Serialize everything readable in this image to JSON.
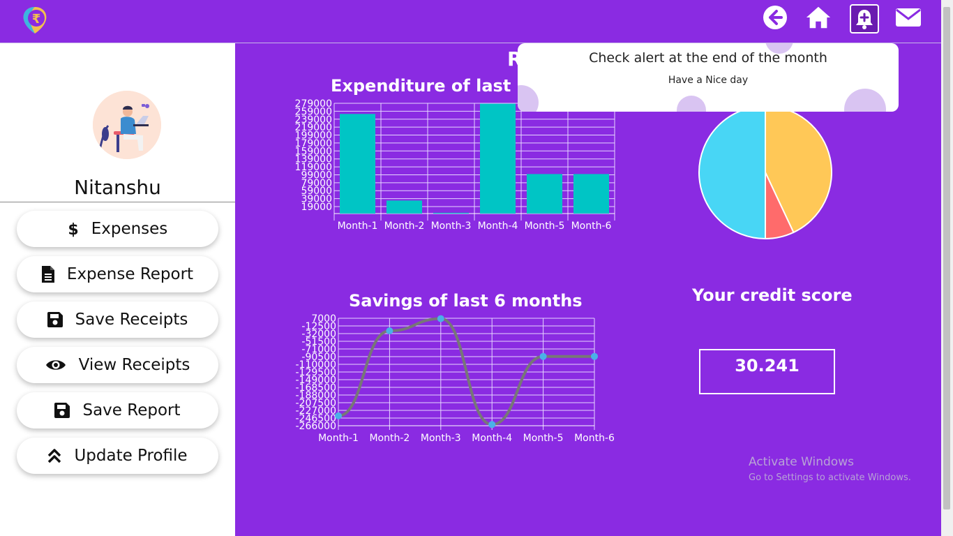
{
  "header": {
    "logo_symbol": "₹",
    "icons": [
      "back-arrow-icon",
      "home-icon",
      "add-alert-icon",
      "mail-icon"
    ]
  },
  "sidebar": {
    "username": "Nitanshu",
    "items": [
      {
        "label": "Expenses",
        "icon": "dollar-icon"
      },
      {
        "label": "Expense Report",
        "icon": "document-icon"
      },
      {
        "label": "Save Receipts",
        "icon": "floppy-icon"
      },
      {
        "label": "View Receipts",
        "icon": "eye-icon"
      },
      {
        "label": "Save Report",
        "icon": "floppy-icon"
      },
      {
        "label": "Update Profile",
        "icon": "double-chevron-up-icon"
      }
    ]
  },
  "main": {
    "partial_heading": "R",
    "credit_title": "Your credit score",
    "credit_score": "30.241"
  },
  "toast": {
    "message": "Check alert at the end of the month",
    "sub": "Have a Nice day"
  },
  "watermark": {
    "line1": "Activate Windows",
    "line2": "Go to Settings to activate Windows."
  },
  "colors": {
    "background": "#8a2be2",
    "bar": "#00c5c5",
    "line": "#777777",
    "point": "#4ab0e8",
    "pie": [
      "#ffc857",
      "#ff6b6b",
      "#48d6f5"
    ]
  },
  "chart_data": [
    {
      "type": "bar",
      "title": "Expenditure of last 6 m",
      "categories": [
        "Month-1",
        "Month-2",
        "Month-3",
        "Month-4",
        "Month-5",
        "Month-6"
      ],
      "values": [
        252000,
        33000,
        2000,
        278000,
        100000,
        100000
      ],
      "yticks": [
        "279000",
        "259000",
        "239000",
        "219000",
        "199000",
        "179000",
        "159000",
        "139000",
        "119000",
        "99000",
        "79000",
        "59000",
        "39000",
        "19000"
      ],
      "ylim": [
        0,
        279000
      ]
    },
    {
      "type": "line",
      "title": "Savings of last 6 months",
      "categories": [
        "Month-1",
        "Month-2",
        "Month-3",
        "Month-4",
        "Month-5",
        "Month-6"
      ],
      "values": [
        -241000,
        -25000,
        6000,
        -263000,
        -90000,
        -90000
      ],
      "yticks": [
        "7000",
        "-12500",
        "-32000",
        "-51500",
        "-71000",
        "-90500",
        "-110000",
        "-129500",
        "-149000",
        "-168500",
        "-188000",
        "-207500",
        "-227000",
        "-246500",
        "-266000"
      ],
      "ylim": [
        -266000,
        7000
      ]
    },
    {
      "type": "pie",
      "values": [
        43,
        7,
        50
      ]
    }
  ]
}
